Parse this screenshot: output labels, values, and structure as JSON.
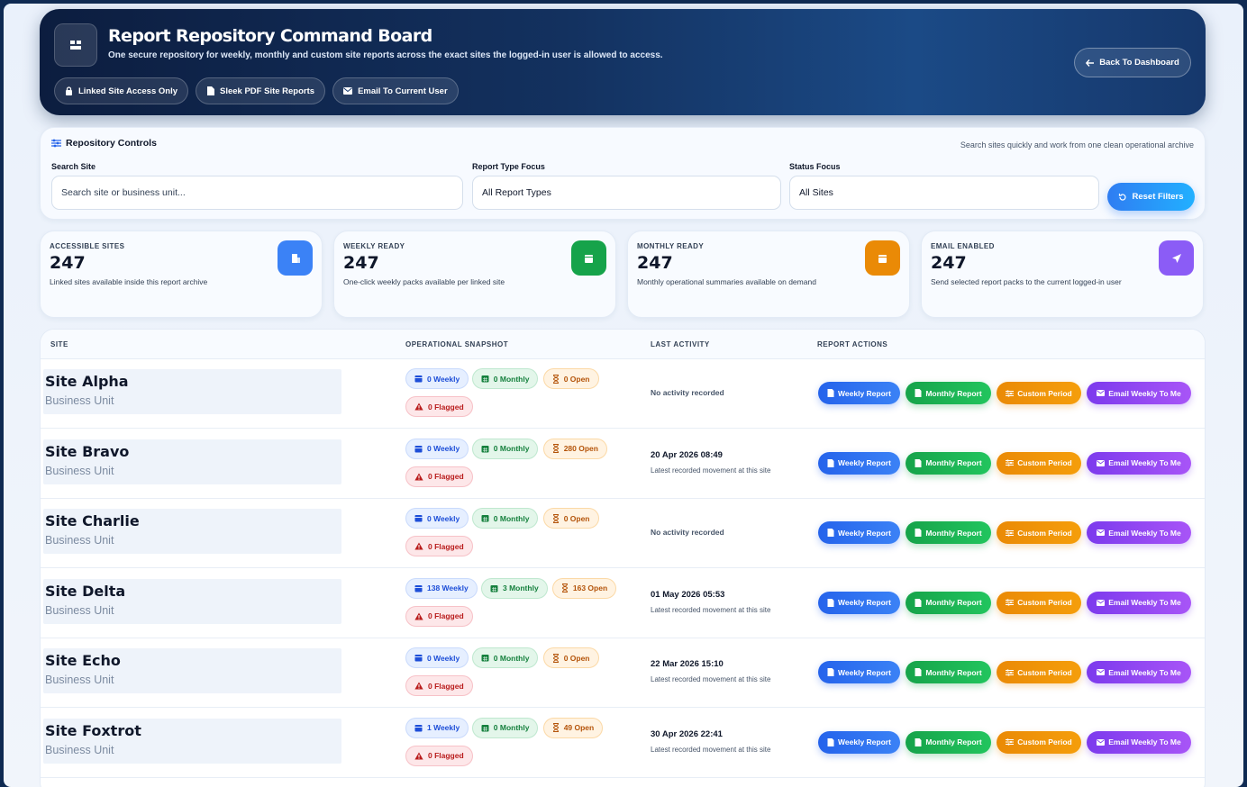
{
  "header": {
    "title": "Report Repository Command Board",
    "subtitle": "One secure repository for weekly, monthly and custom site reports across the exact sites the logged-in user is allowed to access.",
    "chips": [
      "Linked Site Access Only",
      "Sleek PDF Site Reports",
      "Email To Current User"
    ],
    "back_label": "Back To Dashboard"
  },
  "controls": {
    "title": "Repository Controls",
    "hint": "Search sites quickly and work from one clean operational archive",
    "search_label": "Search Site",
    "search_placeholder": "Search site or business unit...",
    "type_label": "Report Type Focus",
    "type_value": "All Report Types",
    "status_label": "Status Focus",
    "status_value": "All Sites",
    "reset_label": "Reset Filters"
  },
  "stats": [
    {
      "label": "ACCESSIBLE SITES",
      "value": "247",
      "desc": "Linked sites available inside this report archive",
      "color": "#3b82f6",
      "icon": "building-icon"
    },
    {
      "label": "WEEKLY READY",
      "value": "247",
      "desc": "One-click weekly packs available per linked site",
      "color": "#16a34a",
      "icon": "calendar-week-icon"
    },
    {
      "label": "MONTHLY READY",
      "value": "247",
      "desc": "Monthly operational summaries available on demand",
      "color": "#ea8a06",
      "icon": "calendar-month-icon"
    },
    {
      "label": "EMAIL ENABLED",
      "value": "247",
      "desc": "Send selected report packs to the current logged-in user",
      "color": "#8b5cf6",
      "icon": "send-icon"
    }
  ],
  "table": {
    "headers": [
      "SITE",
      "OPERATIONAL SNAPSHOT",
      "LAST ACTIVITY",
      "REPORT ACTIONS"
    ],
    "actions": [
      "Weekly Report",
      "Monthly Report",
      "Custom Period",
      "Email Weekly To Me"
    ],
    "rows": [
      {
        "name": "Site Alpha",
        "unit": "Business Unit",
        "weekly": "0 Weekly",
        "monthly": "0 Monthly",
        "open": "0 Open",
        "flagged": "0 Flagged",
        "date": "",
        "sub": "",
        "none": "No activity recorded"
      },
      {
        "name": "Site Bravo",
        "unit": "Business Unit",
        "weekly": "0 Weekly",
        "monthly": "0 Monthly",
        "open": "280 Open",
        "flagged": "0 Flagged",
        "date": "20 Apr 2026 08:49",
        "sub": "Latest recorded movement at this site",
        "none": ""
      },
      {
        "name": "Site Charlie",
        "unit": "Business Unit",
        "weekly": "0 Weekly",
        "monthly": "0 Monthly",
        "open": "0 Open",
        "flagged": "0 Flagged",
        "date": "",
        "sub": "",
        "none": "No activity recorded"
      },
      {
        "name": "Site Delta",
        "unit": "Business Unit",
        "weekly": "138 Weekly",
        "monthly": "3 Monthly",
        "open": "163 Open",
        "flagged": "0 Flagged",
        "date": "01 May 2026 05:53",
        "sub": "Latest recorded movement at this site",
        "none": ""
      },
      {
        "name": "Site Echo",
        "unit": "Business Unit",
        "weekly": "0 Weekly",
        "monthly": "0 Monthly",
        "open": "0 Open",
        "flagged": "0 Flagged",
        "date": "22 Mar 2026 15:10",
        "sub": "Latest recorded movement at this site",
        "none": ""
      },
      {
        "name": "Site Foxtrot",
        "unit": "Business Unit",
        "weekly": "1 Weekly",
        "monthly": "0 Monthly",
        "open": "49 Open",
        "flagged": "0 Flagged",
        "date": "30 Apr 2026 22:41",
        "sub": "Latest recorded movement at this site",
        "none": ""
      }
    ]
  }
}
